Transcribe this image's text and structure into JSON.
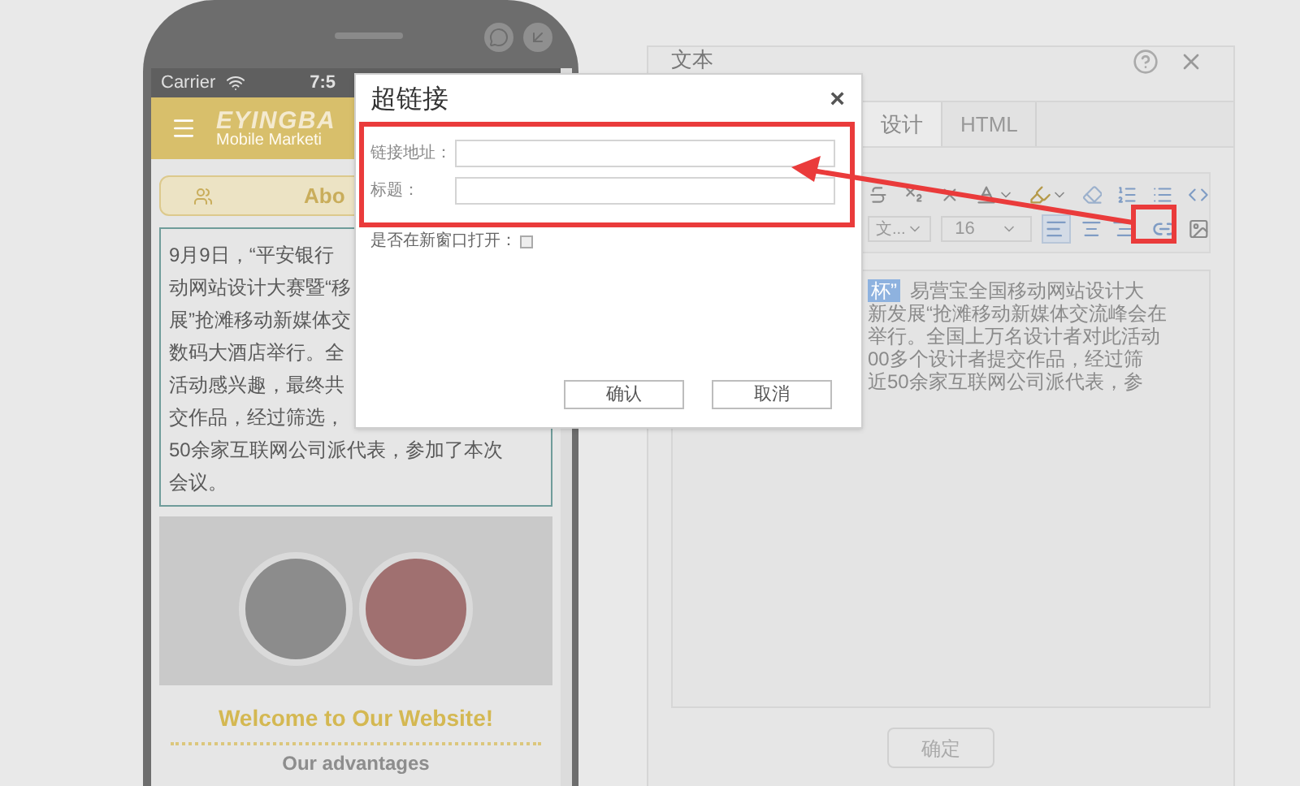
{
  "phone": {
    "status_bar": {
      "carrier": "Carrier",
      "time": "7:5"
    },
    "header": {
      "logo": "EYINGBA",
      "tagline": "Mobile Marketi"
    },
    "tab_label": "Abo",
    "article_lines": [
      "9月9日，“平安银行",
      "动网站设计大赛暨“移",
      "展”抢滩移动新媒体交",
      "数码大酒店举行。全",
      "活动感兴趣，最终共",
      "交作品，经过筛选，",
      "50余家互联网公司派代表，参加了本次",
      "会议。"
    ],
    "welcome_title": "Welcome to Our Website!",
    "subtitle": "Our advantages"
  },
  "editor_panel": {
    "title": "文本",
    "tabs": [
      {
        "label": "设计",
        "selected": true
      },
      {
        "label": "HTML",
        "selected": false
      }
    ],
    "toolbar": {
      "font": "文...",
      "font_size": "16",
      "left_align_active": true
    },
    "content_lines": [
      {
        "text": "杯”",
        "highlighted": true,
        "rest": "易营宝全国移动网站设计大"
      },
      {
        "text": "新发展“抢滩移动新媒体交流峰会在",
        "highlighted": false
      },
      {
        "text": "举行。全国上万名设计者对此活动",
        "highlighted": false
      },
      {
        "text": "00多个设计者提交作品，经过筛",
        "highlighted": false
      },
      {
        "text": "近50余家互联网公司派代表，参",
        "highlighted": false
      }
    ],
    "confirm_button": "确定"
  },
  "dialog": {
    "title": "超链接",
    "close": "×",
    "fields": [
      {
        "label": "链接地址："
      },
      {
        "label": "标题："
      }
    ],
    "new_window": {
      "label": "是否在新窗口打开：",
      "checked": false
    },
    "buttons": [
      "确认",
      "取消"
    ]
  }
}
